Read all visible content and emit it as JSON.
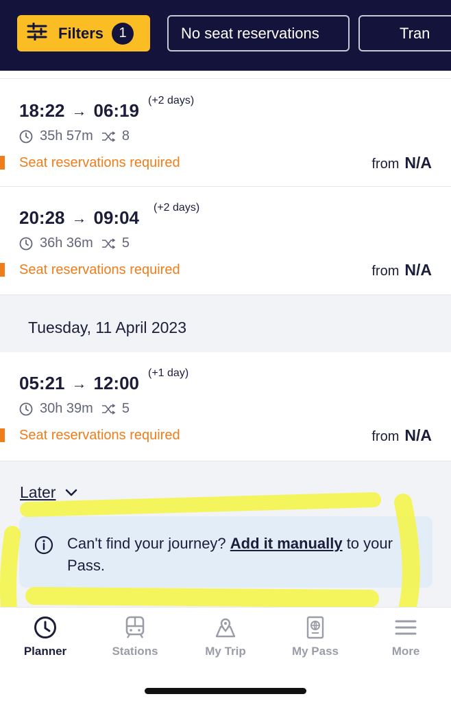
{
  "filter_bar": {
    "filters_label": "Filters",
    "filters_count": "1",
    "seat_chip_label": "No seat reservations",
    "trains_chip_label": "Tran"
  },
  "journeys": [
    {
      "departure": "18:22",
      "arrival": "06:19",
      "day_offset": "(+2 days)",
      "duration": "35h 57m",
      "changes": "8",
      "status": "Seat reservations required",
      "price_prefix": "from",
      "price": "N/A"
    },
    {
      "departure": "20:28",
      "arrival": "09:04",
      "day_offset": "(+2 days)",
      "duration": "36h 36m",
      "changes": "5",
      "status": "Seat reservations required",
      "price_prefix": "from",
      "price": "N/A"
    },
    {
      "departure": "05:21",
      "arrival": "12:00",
      "day_offset": "(+1 day)",
      "duration": "30h 39m",
      "changes": "5",
      "status": "Seat reservations required",
      "price_prefix": "from",
      "price": "N/A"
    }
  ],
  "date_header": "Tuesday, 11 April 2023",
  "later_label": "Later",
  "info": {
    "text_before": "Can't find your journey? ",
    "link": "Add it manually",
    "text_after": " to your Pass."
  },
  "nav": {
    "items": [
      {
        "label": "Planner",
        "icon": "clock-icon",
        "active": true
      },
      {
        "label": "Stations",
        "icon": "train-icon",
        "active": false
      },
      {
        "label": "My Trip",
        "icon": "map-pin-icon",
        "active": false
      },
      {
        "label": "My Pass",
        "icon": "passport-icon",
        "active": false
      },
      {
        "label": "More",
        "icon": "menu-icon",
        "active": false
      }
    ]
  },
  "colors": {
    "navy": "#13133b",
    "accent_yellow": "#fbbd24",
    "warning_orange": "#ef7d1a",
    "info_blue": "#e2edf8",
    "highlight_yellow": "#f5f542"
  }
}
